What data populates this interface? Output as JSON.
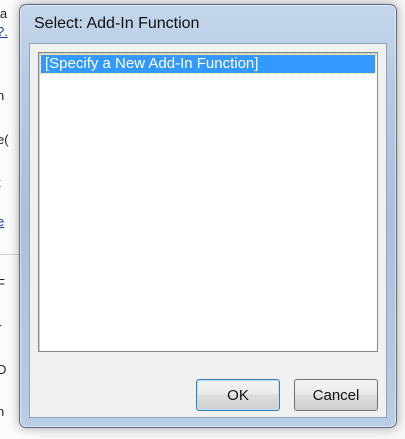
{
  "background_window": {
    "fragments": [
      "la",
      "?.",
      "n",
      "e(",
      "t",
      "e",
      "F",
      "r",
      "D",
      "n"
    ]
  },
  "dialog": {
    "title": "Select: Add-In Function",
    "list": {
      "items": [
        {
          "label": "[Specify a New Add-In Function]",
          "selected": true
        }
      ]
    },
    "buttons": {
      "ok_label": "OK",
      "cancel_label": "Cancel"
    }
  },
  "colors": {
    "selection": "#3399ff",
    "frame": "#b6cbe3"
  }
}
